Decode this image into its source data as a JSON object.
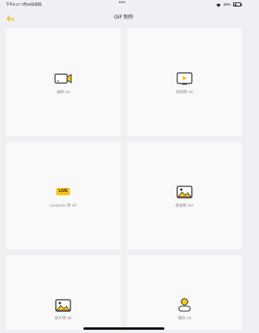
{
  "status_bar": {
    "time": "下午6:17  7月30日周四",
    "dots": "•••",
    "battery": "39%"
  },
  "nav": {
    "title": "GIF 制作",
    "back_icon": "back-arrow-icon"
  },
  "tiles": [
    {
      "label": "录制 Gif",
      "icon": "video-camera-icon"
    },
    {
      "label": "视频转 Gif",
      "icon": "video-play-icon"
    },
    {
      "label": "Livephoto 转 Gif",
      "icon": "live-badge",
      "badge": "LIVE"
    },
    {
      "label": "连拍转 GIF",
      "icon": "burst-photos-icon"
    },
    {
      "label": "照片转 Gif",
      "icon": "photo-icon"
    },
    {
      "label": "我的 Gif",
      "icon": "user-icon"
    }
  ],
  "colors": {
    "accent": "#f5c518",
    "background": "#efeff4",
    "tile": "#f9f9f9"
  }
}
